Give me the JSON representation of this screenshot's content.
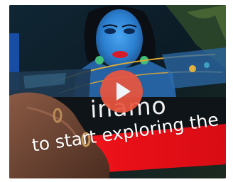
{
  "video": {
    "logo_text": "inamo",
    "ticker_text": "to start exploring the",
    "play_icon": "play-icon"
  },
  "colors": {
    "play_button": "#e9553f",
    "red_banner": "#e8141c",
    "face_projection": "#2f8fd8"
  }
}
